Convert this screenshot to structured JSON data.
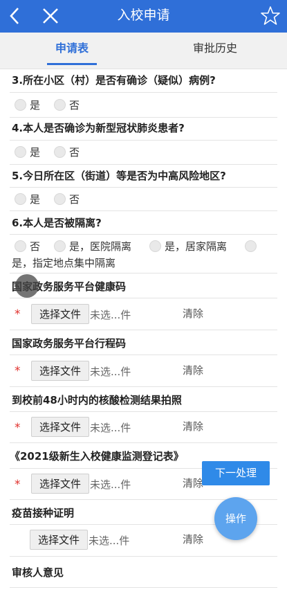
{
  "header": {
    "title": "入校申请",
    "accent": "#2f6fd8",
    "icons": [
      "back-arrow-icon",
      "close-x-icon",
      "star-icon"
    ]
  },
  "tabs": [
    {
      "label": "申请表",
      "active": true
    },
    {
      "label": "审批历史",
      "active": false
    }
  ],
  "questions": [
    {
      "text": "3.所在小区（村）是否有确诊（疑似）病例?",
      "options": [
        "是",
        "否"
      ]
    },
    {
      "text": "4.本人是否确诊为新型冠状肺炎患者?",
      "options": [
        "是",
        "否"
      ]
    },
    {
      "text": "5.今日所在区（街道）等是否为中高风险地区?",
      "options": [
        "是",
        "否"
      ]
    },
    {
      "text": "6.本人是否被隔离?",
      "options": [
        "否",
        "是，医院隔离",
        "是，居家隔离",
        "是，指定地点集中隔离"
      ]
    }
  ],
  "uploads": [
    {
      "label": "国家政务服务平台健康码",
      "required": true,
      "button": "选择文件",
      "status": "未选...件",
      "clear": "清除"
    },
    {
      "label": "国家政务服务平台行程码",
      "required": true,
      "button": "选择文件",
      "status": "未选...件",
      "clear": "清除"
    },
    {
      "label": "到校前48小时内的核酸检测结果拍照",
      "required": true,
      "button": "选择文件",
      "status": "未选...件",
      "clear": "清除"
    },
    {
      "label": "《2021级新生入校健康监测登记表》",
      "required": true,
      "button": "选择文件",
      "status": "未选...件",
      "clear": "清除"
    },
    {
      "label": "疫苗接种证明",
      "required": false,
      "button": "选择文件",
      "status": "未选...件",
      "clear": "清除"
    }
  ],
  "required_mark": "*",
  "reviewer_opinion": "审核人意见",
  "actions": {
    "next": "下一处理",
    "operate": "操作"
  }
}
